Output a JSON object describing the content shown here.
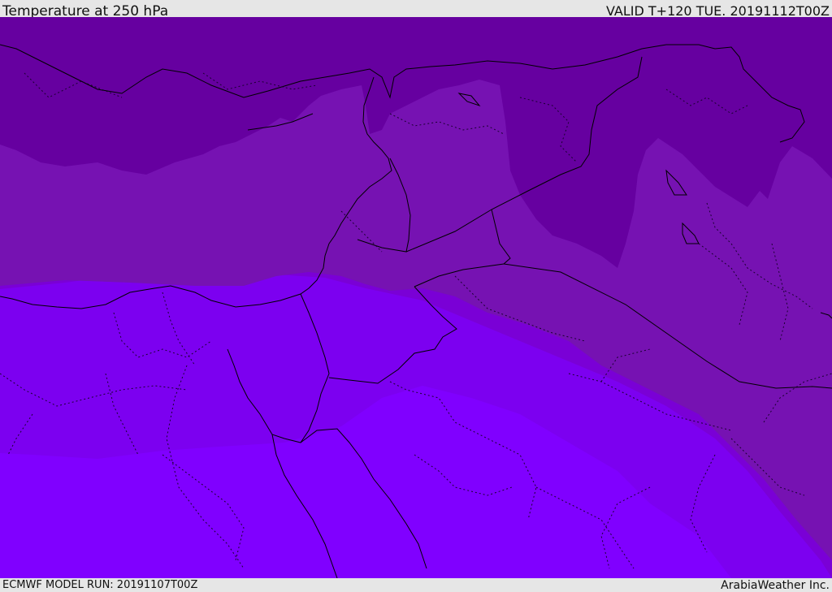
{
  "header": {
    "title": "Temperature at 250 hPa",
    "valid": "VALID T+120 TUE. 20191112T00Z"
  },
  "footer": {
    "model_run": "ECMWF MODEL RUN: 20191107T00Z",
    "credit": "ArabiaWeather Inc."
  },
  "map": {
    "variable": "temperature",
    "pressure_level_hpa": 250,
    "bands": [
      {
        "name": "coldest",
        "color": "#6600a0"
      },
      {
        "name": "band-2",
        "color": "#7612b2"
      },
      {
        "name": "band-3",
        "color": "#7a00d6"
      },
      {
        "name": "band-4",
        "color": "#7c00f0"
      },
      {
        "name": "warmest",
        "color": "#8000ff"
      }
    ],
    "boundary_color": "#000000"
  }
}
